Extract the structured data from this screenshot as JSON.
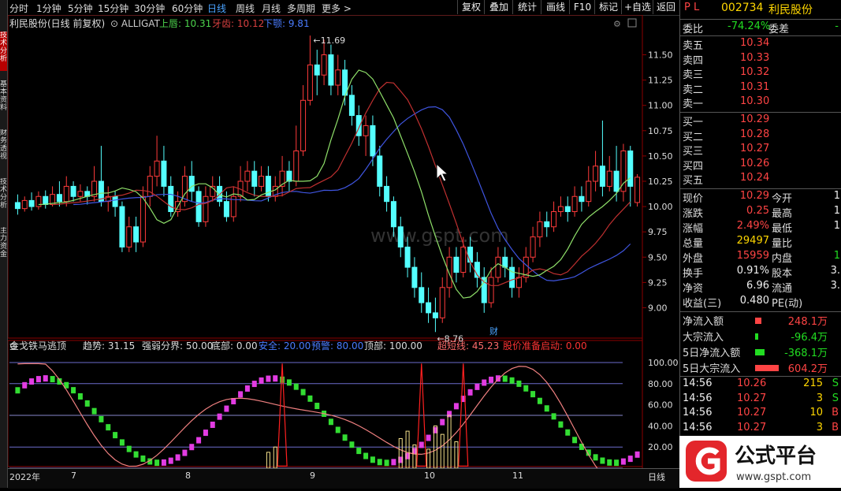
{
  "period_tabs": [
    "分时",
    "1分钟",
    "5分钟",
    "15分钟",
    "30分钟",
    "60分钟",
    "日线",
    "周线",
    "月线",
    "多周期",
    "更多 >"
  ],
  "active_tab": "日线",
  "toolbar_buttons": [
    "复权",
    "叠加",
    "统计",
    "画线",
    "F10",
    "标记",
    "+自选",
    "返回"
  ],
  "vertical_tabs": [
    "技术分析",
    "基本资料",
    "财务透视",
    "技术分析",
    "主力资金"
  ],
  "main_header": {
    "stock_name": "利民股份(日线 前复权)",
    "indicator": "ALLIGAT",
    "upper_label": "上唇: 10.31",
    "teeth_label": "牙齿: 10.12",
    "jaw_label": "下颚: 9.81"
  },
  "price_axis": [
    "11.50",
    "11.25",
    "11.00",
    "10.75",
    "10.50",
    "10.25",
    "10.00",
    "9.75",
    "9.50",
    "9.25",
    "9.00"
  ],
  "high_marker": "11.69",
  "low_marker": "8.76",
  "finance_marker": "财",
  "watermark": "www.gspt.com",
  "sub_header": {
    "name": "金戈铁马逃顶",
    "trend": "趋势: 31.15",
    "strong_weak": "强弱分界: 50.00",
    "bottom": "底部: 0.00",
    "safe": "安全: 20.00",
    "warn": "预警: 80.00",
    "top": "顶部: 100.00",
    "over_short": "超短线: 45.23",
    "ready": "股价准备启动: 0.00"
  },
  "sub_axis": [
    "100.00",
    "80.00",
    "60.00",
    "40.00",
    "20.00"
  ],
  "x_axis": [
    "2022年",
    "7",
    "8",
    "9",
    "10",
    "11"
  ],
  "bottom_right_label": "日线",
  "panel": {
    "pl": "P L",
    "code": "002734",
    "name": "利民股份",
    "weibi_label": "委比",
    "weibi": "-74.24%",
    "weicha_label": "委差",
    "weicha": "-",
    "asks": [
      {
        "label": "卖五",
        "price": "10.34"
      },
      {
        "label": "卖四",
        "price": "10.33"
      },
      {
        "label": "卖三",
        "price": "10.32"
      },
      {
        "label": "卖二",
        "price": "10.31"
      },
      {
        "label": "卖一",
        "price": "10.30"
      }
    ],
    "bids": [
      {
        "label": "买一",
        "price": "10.29"
      },
      {
        "label": "买二",
        "price": "10.28"
      },
      {
        "label": "买三",
        "price": "10.27"
      },
      {
        "label": "买四",
        "price": "10.26"
      },
      {
        "label": "买五",
        "price": "10.24"
      }
    ],
    "quote": [
      {
        "l": "现价",
        "v": "10.29",
        "r": "今开",
        "rv": "1"
      },
      {
        "l": "涨跌",
        "v": "0.25",
        "r": "最高",
        "rv": "1"
      },
      {
        "l": "涨幅",
        "v": "2.49%",
        "r": "最低",
        "rv": "1"
      },
      {
        "l": "总量",
        "v": "29497",
        "r": "量比",
        "rv": ""
      },
      {
        "l": "外盘",
        "v": "15959",
        "r": "内盘",
        "rv": "1"
      },
      {
        "l": "换手",
        "v": "0.91%",
        "r": "股本",
        "rv": "3."
      },
      {
        "l": "净资",
        "v": "6.96",
        "r": "流通",
        "rv": "3."
      },
      {
        "l": "收益(三)",
        "v": "0.480",
        "r": "PE(动)",
        "rv": ""
      }
    ],
    "flows": [
      {
        "l": "净流入额",
        "v": "248.1万"
      },
      {
        "l": "大宗流入",
        "v": "-96.4万"
      },
      {
        "l": "5日净流入额",
        "v": "-368.1万"
      },
      {
        "l": "5日大宗流入",
        "v": "604.2万"
      }
    ],
    "ticks": [
      {
        "t": "14:56",
        "p": "10.26",
        "q": "215",
        "s": "S"
      },
      {
        "t": "14:56",
        "p": "10.27",
        "q": "3",
        "s": "S"
      },
      {
        "t": "14:56",
        "p": "10.27",
        "q": "10",
        "s": "B"
      },
      {
        "t": "14:56",
        "p": "10.27",
        "q": "3",
        "s": "B"
      }
    ],
    "logo_text": "公式平台",
    "logo_url": "www.gspt.com"
  },
  "chart_data": {
    "type": "candlestick",
    "title": "利民股份(日线 前复权)",
    "ylim": [
      8.7,
      11.8
    ],
    "high": 11.69,
    "low": 8.76,
    "series": [
      {
        "name": "上唇",
        "last": 10.31
      },
      {
        "name": "牙齿",
        "last": 10.12
      },
      {
        "name": "下颚",
        "last": 9.81
      }
    ],
    "candles": [
      [
        10.04,
        9.98,
        10.12,
        9.92
      ],
      [
        9.98,
        10.06,
        10.1,
        9.95
      ],
      [
        10.06,
        10.0,
        10.14,
        9.96
      ],
      [
        10.0,
        10.1,
        10.15,
        9.97
      ],
      [
        10.1,
        10.02,
        10.16,
        9.98
      ],
      [
        10.02,
        10.12,
        10.2,
        10.0
      ],
      [
        10.12,
        10.05,
        10.25,
        10.0
      ],
      [
        10.05,
        10.2,
        10.3,
        10.0
      ],
      [
        10.2,
        10.1,
        10.25,
        10.05
      ],
      [
        10.1,
        10.15,
        10.22,
        10.05
      ],
      [
        10.15,
        10.1,
        10.2,
        10.02
      ],
      [
        10.1,
        10.25,
        10.4,
        10.05
      ],
      [
        10.25,
        10.05,
        10.6,
        10.0
      ],
      [
        10.05,
        10.1,
        10.2,
        9.95
      ],
      [
        10.1,
        10.0,
        10.15,
        9.9
      ],
      [
        10.0,
        9.6,
        10.05,
        9.55
      ],
      [
        9.6,
        9.8,
        9.9,
        9.55
      ],
      [
        9.8,
        9.65,
        9.9,
        9.55
      ],
      [
        9.65,
        10.1,
        10.2,
        9.6
      ],
      [
        10.1,
        10.3,
        10.4,
        10.0
      ],
      [
        10.3,
        10.45,
        10.7,
        10.2
      ],
      [
        10.45,
        10.2,
        10.6,
        10.1
      ],
      [
        10.2,
        9.95,
        10.3,
        9.9
      ],
      [
        9.95,
        10.05,
        10.15,
        9.9
      ],
      [
        10.05,
        10.3,
        10.4,
        10.0
      ],
      [
        10.3,
        10.15,
        10.45,
        10.05
      ],
      [
        10.15,
        9.85,
        10.2,
        9.8
      ],
      [
        9.85,
        10.1,
        10.2,
        9.8
      ],
      [
        10.1,
        10.2,
        10.3,
        10.05
      ],
      [
        10.2,
        10.05,
        10.3,
        10.0
      ],
      [
        10.05,
        9.9,
        10.15,
        9.85
      ],
      [
        9.9,
        10.1,
        10.2,
        9.85
      ],
      [
        10.1,
        10.25,
        10.4,
        10.05
      ],
      [
        10.25,
        10.35,
        10.45,
        10.15
      ],
      [
        10.35,
        10.2,
        10.45,
        10.1
      ],
      [
        10.2,
        10.3,
        10.4,
        10.15
      ],
      [
        10.3,
        10.1,
        10.4,
        10.05
      ],
      [
        10.1,
        10.2,
        10.3,
        10.05
      ],
      [
        10.2,
        10.35,
        10.5,
        10.1
      ],
      [
        10.35,
        10.25,
        10.45,
        10.15
      ],
      [
        10.25,
        10.55,
        10.8,
        10.2
      ],
      [
        10.55,
        11.05,
        11.2,
        10.5
      ],
      [
        11.05,
        11.4,
        11.69,
        11.0
      ],
      [
        11.4,
        11.3,
        11.55,
        11.1
      ],
      [
        11.3,
        11.5,
        11.65,
        11.2
      ],
      [
        11.5,
        11.2,
        11.6,
        11.1
      ],
      [
        11.2,
        11.35,
        11.5,
        11.1
      ],
      [
        11.35,
        11.1,
        11.45,
        11.0
      ],
      [
        11.1,
        10.9,
        11.2,
        10.8
      ],
      [
        10.9,
        10.7,
        11.0,
        10.6
      ],
      [
        10.7,
        10.8,
        10.9,
        10.5
      ],
      [
        10.8,
        10.5,
        10.9,
        10.4
      ],
      [
        10.5,
        10.2,
        10.6,
        10.1
      ],
      [
        10.2,
        10.05,
        10.3,
        9.95
      ],
      [
        10.05,
        9.8,
        10.1,
        9.7
      ],
      [
        9.8,
        9.6,
        9.9,
        9.5
      ],
      [
        9.6,
        9.4,
        9.7,
        9.3
      ],
      [
        9.4,
        9.2,
        9.5,
        9.1
      ],
      [
        9.2,
        9.05,
        9.35,
        8.95
      ],
      [
        9.05,
        8.95,
        9.2,
        8.85
      ],
      [
        8.95,
        8.9,
        9.1,
        8.76
      ],
      [
        8.9,
        9.2,
        9.3,
        8.85
      ],
      [
        9.2,
        9.5,
        9.6,
        9.1
      ],
      [
        9.5,
        9.35,
        9.6,
        9.25
      ],
      [
        9.35,
        9.6,
        9.7,
        9.3
      ],
      [
        9.6,
        9.45,
        9.7,
        9.35
      ],
      [
        9.45,
        9.3,
        9.55,
        9.2
      ],
      [
        9.3,
        9.05,
        9.4,
        8.95
      ],
      [
        9.05,
        9.3,
        9.4,
        9.0
      ],
      [
        9.3,
        9.5,
        9.6,
        9.25
      ],
      [
        9.5,
        9.4,
        9.6,
        9.3
      ],
      [
        9.4,
        9.2,
        9.5,
        9.1
      ],
      [
        9.2,
        9.3,
        9.4,
        9.1
      ],
      [
        9.3,
        9.5,
        9.6,
        9.25
      ],
      [
        9.5,
        9.7,
        9.8,
        9.45
      ],
      [
        9.7,
        9.85,
        9.95,
        9.6
      ],
      [
        9.85,
        9.8,
        9.95,
        9.7
      ],
      [
        9.8,
        9.95,
        10.05,
        9.75
      ],
      [
        9.95,
        10.0,
        10.1,
        9.9
      ],
      [
        10.0,
        9.95,
        10.1,
        9.85
      ],
      [
        9.95,
        10.1,
        10.2,
        9.9
      ],
      [
        10.1,
        10.05,
        10.2,
        9.95
      ],
      [
        10.05,
        10.25,
        10.4,
        10.0
      ],
      [
        10.25,
        10.4,
        10.55,
        10.15
      ],
      [
        10.4,
        10.2,
        10.85,
        10.1
      ],
      [
        10.2,
        10.35,
        10.5,
        10.15
      ],
      [
        10.35,
        10.15,
        10.6,
        10.05
      ],
      [
        10.15,
        10.55,
        10.62,
        10.05
      ],
      [
        10.55,
        10.2,
        10.6,
        10.0
      ],
      [
        10.04,
        10.29,
        10.32,
        10.0
      ]
    ]
  }
}
